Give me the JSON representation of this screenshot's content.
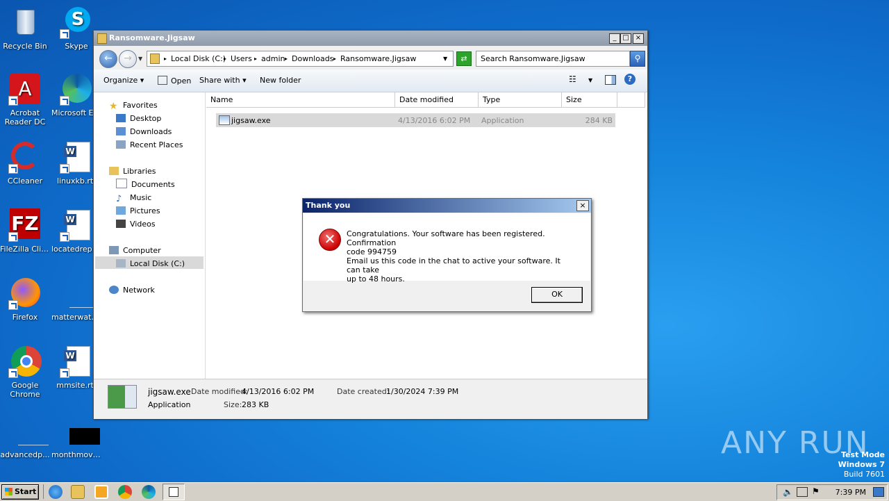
{
  "desktop": {
    "icons": [
      {
        "label": "Recycle Bin"
      },
      {
        "label": "Skype"
      },
      {
        "label": "Acrobat Reader DC"
      },
      {
        "label": "Microsoft Edge"
      },
      {
        "label": "CCleaner"
      },
      {
        "label": "linuxkb.rtf"
      },
      {
        "label": "FileZilla Client"
      },
      {
        "label": "locatedrepa..."
      },
      {
        "label": "Firefox"
      },
      {
        "label": "matterwate..."
      },
      {
        "label": "Google Chrome"
      },
      {
        "label": "mmsite.rtf"
      },
      {
        "label": "advancedp..."
      },
      {
        "label": "monthmovin..."
      }
    ]
  },
  "explorer": {
    "title": "Ransomware.Jigsaw",
    "breadcrumbs": [
      "Local Disk (C:)",
      "Users",
      "admin",
      "Downloads",
      "Ransomware.Jigsaw"
    ],
    "search_placeholder": "Search Ransomware.Jigsaw",
    "toolbar": {
      "organize": "Organize",
      "open": "Open",
      "share": "Share with",
      "new_folder": "New folder"
    },
    "nav": {
      "favorites": "Favorites",
      "desktop": "Desktop",
      "downloads": "Downloads",
      "recent": "Recent Places",
      "libraries": "Libraries",
      "documents": "Documents",
      "music": "Music",
      "pictures": "Pictures",
      "videos": "Videos",
      "computer": "Computer",
      "local_disk": "Local Disk (C:)",
      "network": "Network"
    },
    "columns": {
      "name": "Name",
      "date": "Date modified",
      "type": "Type",
      "size": "Size"
    },
    "file": {
      "name": "jigsaw.exe",
      "date": "4/13/2016 6:02 PM",
      "type": "Application",
      "size": "284 KB"
    },
    "details": {
      "name": "jigsaw.exe",
      "type": "Application",
      "modified_label": "Date modified:",
      "modified": "4/13/2016 6:02 PM",
      "size_label": "Size:",
      "size": "283 KB",
      "created_label": "Date created:",
      "created": "1/30/2024 7:39 PM"
    }
  },
  "dialog": {
    "title": "Thank you",
    "line1": "Congratulations. Your software has been registered. Confirmation",
    "line2": "code 994759",
    "line3": "Email us this code in the chat to active your software. It can take",
    "line4": "up to 48 hours.",
    "ok": "OK",
    "close": "×"
  },
  "taskbar": {
    "start": "Start",
    "time": "7:39 PM"
  },
  "watermark": {
    "line1": "Test Mode",
    "line2": "Windows 7",
    "line3": "Build 7601",
    "brand": "ANY RUN"
  }
}
